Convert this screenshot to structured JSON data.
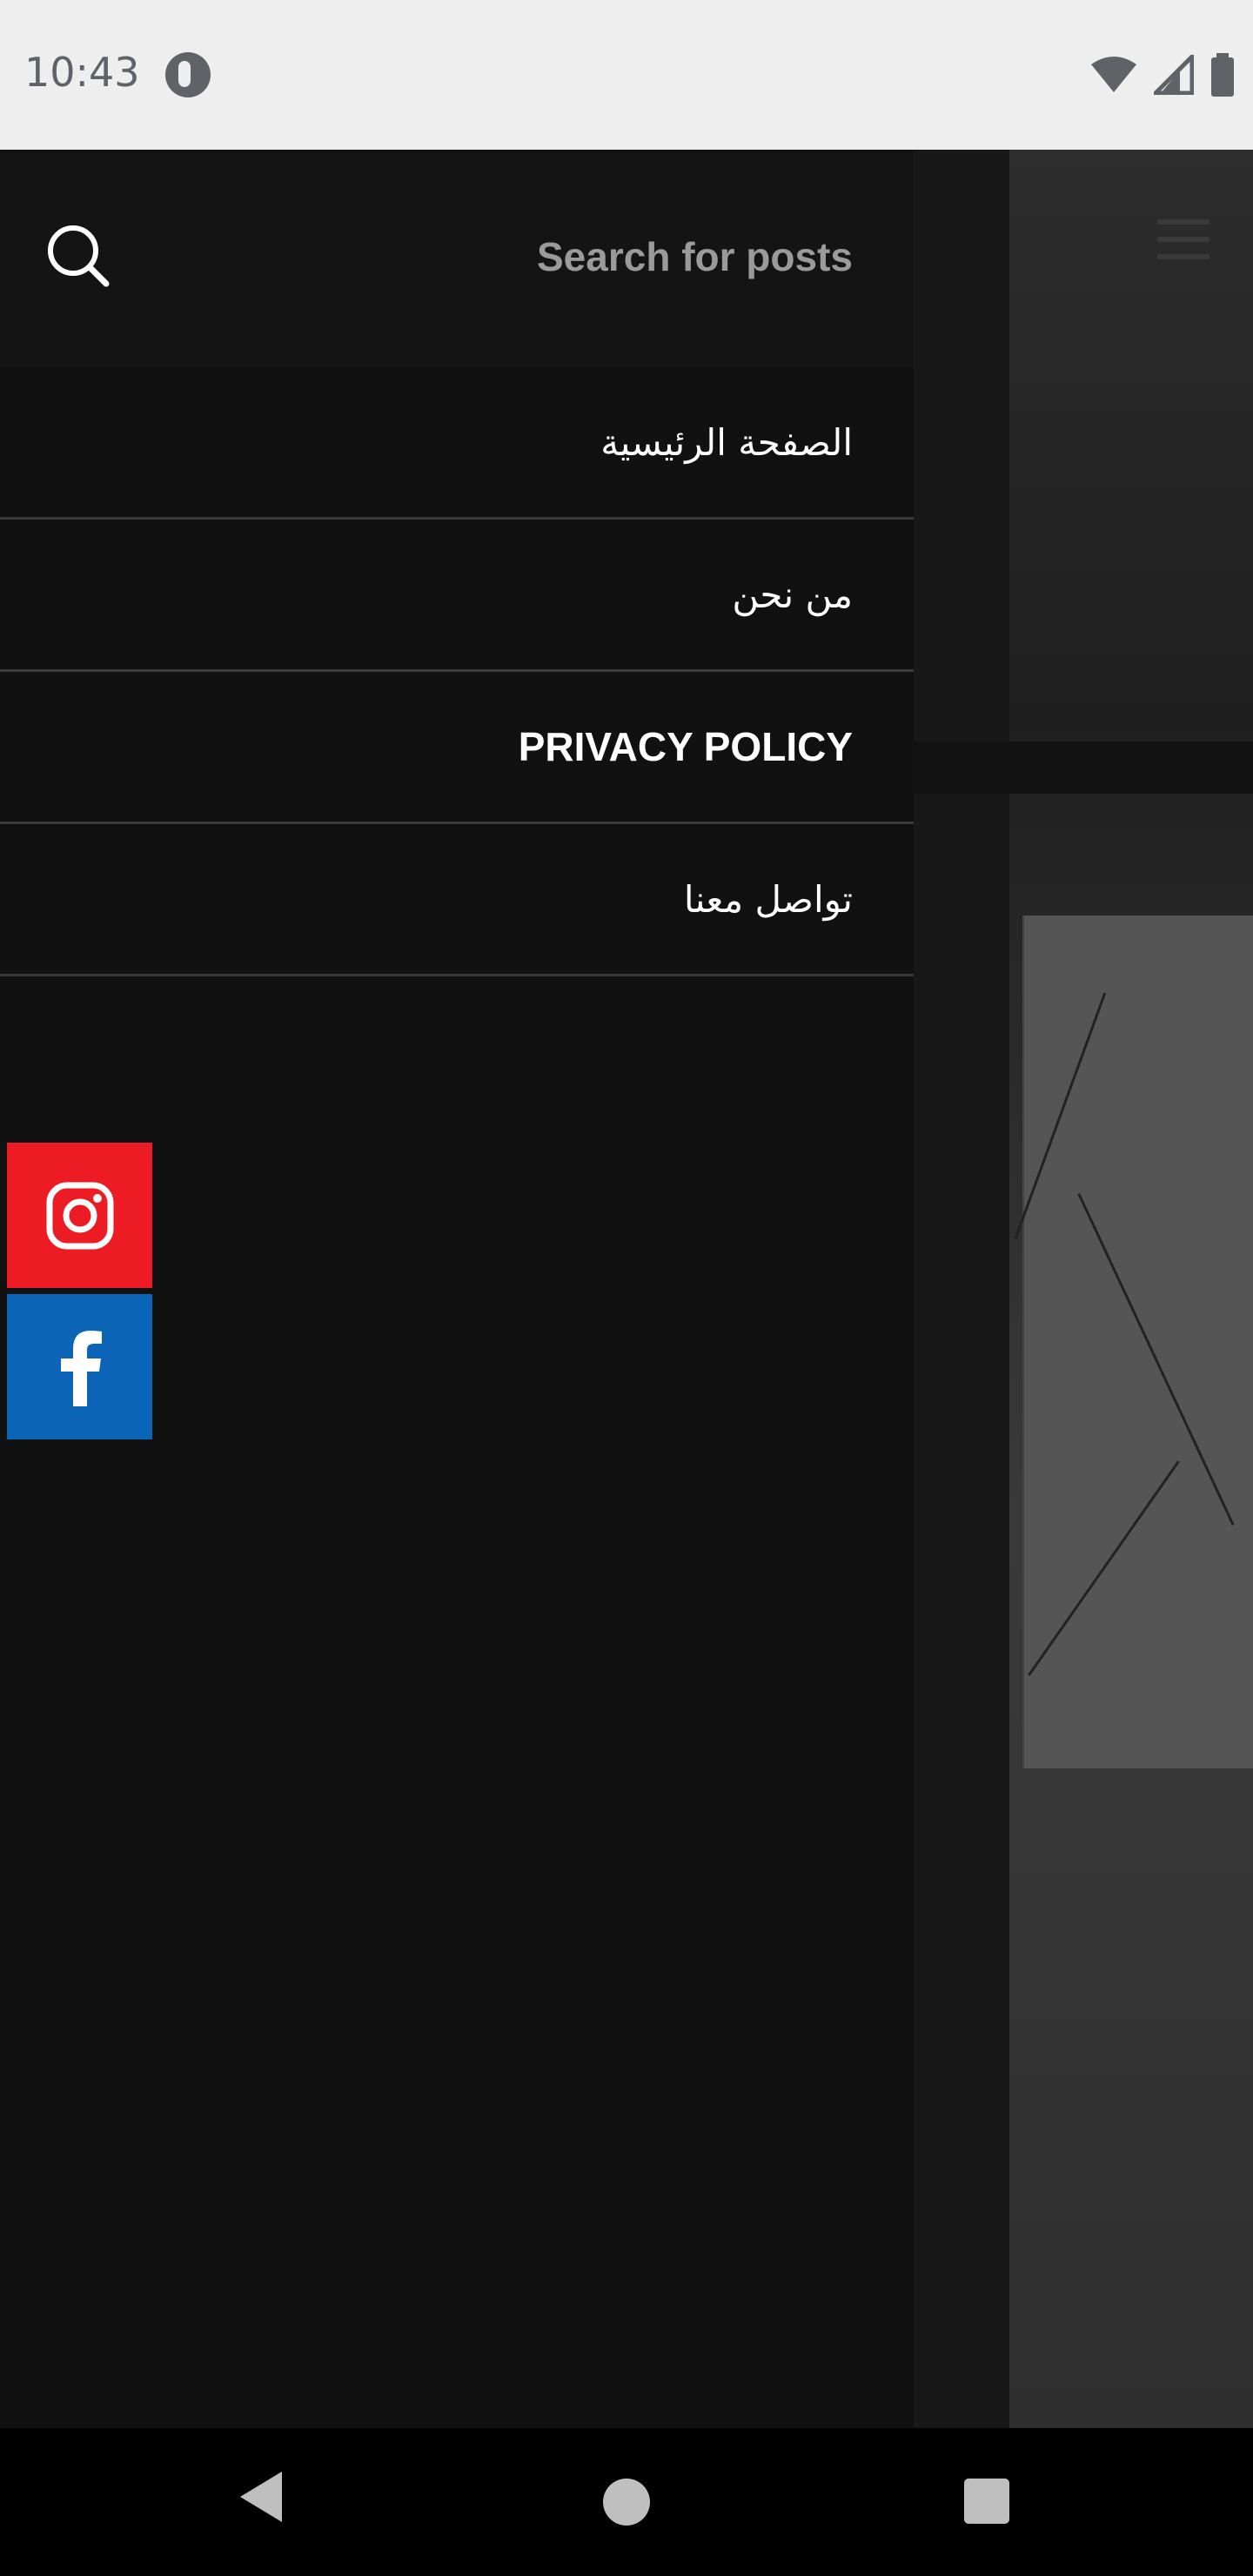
{
  "status_bar": {
    "time": "10:43"
  },
  "search": {
    "placeholder": "Search for posts"
  },
  "menu": {
    "items": [
      {
        "label": "الصفحة الرئيسية"
      },
      {
        "label": "من نحن"
      },
      {
        "label": "PRIVACY POLICY"
      },
      {
        "label": "تواصل معنا"
      }
    ]
  },
  "social": {
    "instagram_color": "#ed1c24",
    "facebook_color": "#0b64b6"
  },
  "icons": {
    "search": "search-icon",
    "instagram": "instagram-icon",
    "facebook": "facebook-icon",
    "menu": "hamburger-menu-icon",
    "back": "back-icon",
    "home": "home-icon",
    "recent": "recent-apps-icon"
  },
  "colors": {
    "drawer_bg": "#111111",
    "divider": "#3a3a3a",
    "text": "#ffffff",
    "placeholder": "#9a9a9a"
  }
}
